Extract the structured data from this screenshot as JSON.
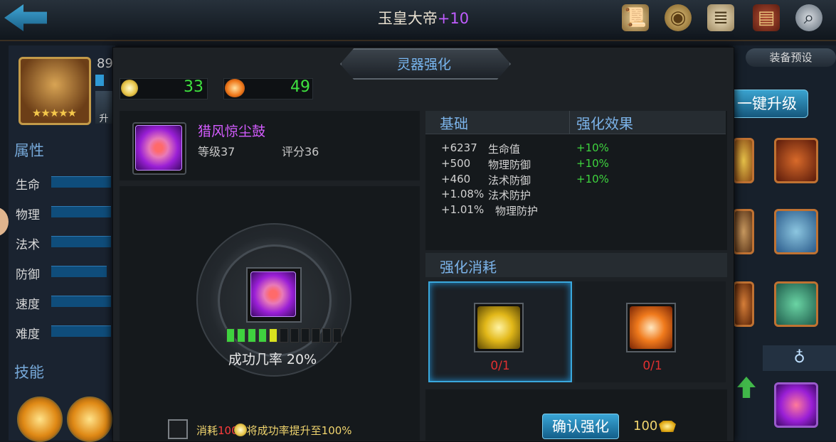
{
  "topbar": {
    "title": "玉皇大帝",
    "title_suffix": "+10"
  },
  "icons": {
    "back": "back-arrow-icon",
    "scroll": "scroll-icon",
    "medal": "medal-icon",
    "document": "document-icon",
    "book": "book-icon",
    "magnifier": "magnifier-icon"
  },
  "hero": {
    "level": "89",
    "stars": "★★★★★",
    "upgrade_label": "升"
  },
  "left_panel": {
    "attributes_title": "属性",
    "attributes": [
      "生命",
      "物理",
      "法术",
      "防御",
      "速度",
      "难度"
    ],
    "skills_title": "技能"
  },
  "right_panel": {
    "equip_preset": "装备预设",
    "one_key_upgrade": "一键升级"
  },
  "modal": {
    "title": "灵器强化",
    "currency_stone": "33",
    "currency_fire": "49",
    "item": {
      "name": "猎风惊尘鼓",
      "level": "等级37",
      "score": "评分36"
    },
    "progress": {
      "filled_green": 4,
      "filled_yellow": 1,
      "total": 11
    },
    "success_rate": "成功几率 20%",
    "consume_option": {
      "prefix": "消耗",
      "amount": "100",
      "suffix": "将成功率提升至100%"
    },
    "stats": {
      "col_base": "基础",
      "col_effect": "强化效果",
      "rows": [
        {
          "value": "+6237",
          "name": "生命值",
          "bonus": "+10%"
        },
        {
          "value": "+500",
          "name": "物理防御",
          "bonus": "+10%"
        },
        {
          "value": "+460",
          "name": "法术防御",
          "bonus": "+10%"
        },
        {
          "value": "+1.08%",
          "name": "法术防护",
          "bonus": ""
        },
        {
          "value": "+1.01%",
          "name": "物理防护",
          "bonus": ""
        }
      ]
    },
    "consume_title": "强化消耗",
    "materials": [
      {
        "count": "0/1",
        "icon": "gold-pentagon-gem-icon"
      },
      {
        "count": "0/1",
        "icon": "orange-hexagon-gem-icon"
      }
    ],
    "confirm_label": "确认强化",
    "confirm_cost": "100"
  }
}
